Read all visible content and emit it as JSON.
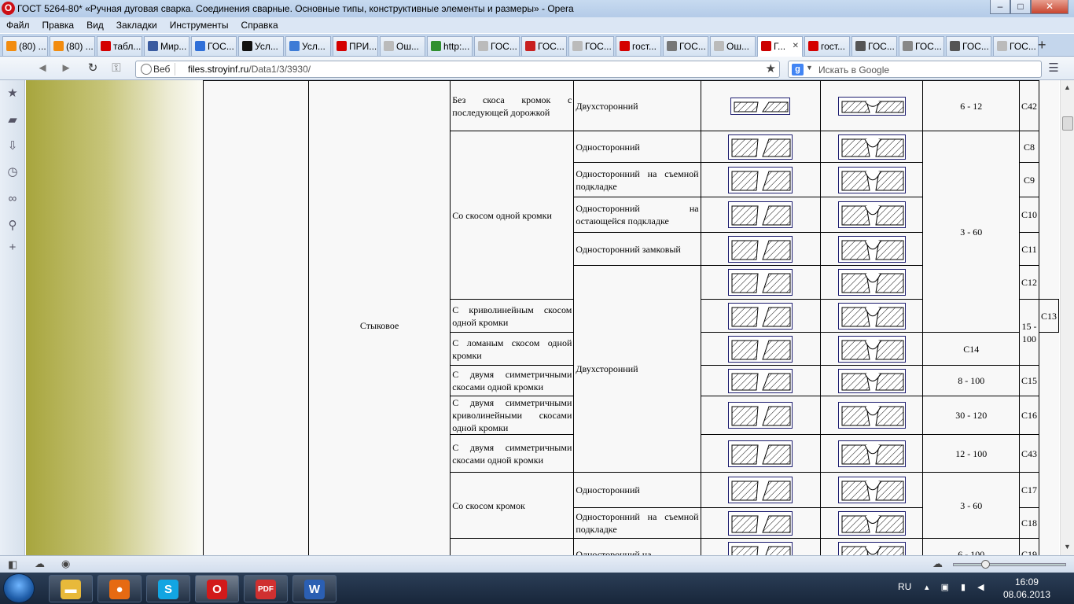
{
  "window": {
    "title": "ГОСТ 5264-80* «Ручная дуговая сварка. Соединения сварные. Основные типы, конструктивные элементы и размеры» - Opera",
    "minimize": "–",
    "maximize": "□",
    "close": "✕"
  },
  "menu": [
    "Файл",
    "Правка",
    "Вид",
    "Закладки",
    "Инструменты",
    "Справка"
  ],
  "tabs": [
    {
      "label": "(80) ...",
      "icon": "odnoklassniki-icon",
      "color": "#f28c0f"
    },
    {
      "label": "(80) ...",
      "icon": "odnoklassniki-icon",
      "color": "#f28c0f"
    },
    {
      "label": "табл...",
      "icon": "yandex-icon",
      "color": "#d40000"
    },
    {
      "label": "Мир...",
      "icon": "site-icon",
      "color": "#3a5ba0"
    },
    {
      "label": "ГОС...",
      "icon": "site-icon",
      "color": "#2f6fd8"
    },
    {
      "label": "Усл...",
      "icon": "site-icon",
      "color": "#111111"
    },
    {
      "label": "Усл...",
      "icon": "site-icon",
      "color": "#3d7bd6"
    },
    {
      "label": "ПРИ...",
      "icon": "yandex-icon",
      "color": "#d40000"
    },
    {
      "label": "Ош...",
      "icon": "page-icon",
      "color": "#bbbbbb"
    },
    {
      "label": "http:...",
      "icon": "gear-icon",
      "color": "#2f8f2f"
    },
    {
      "label": "ГОС...",
      "icon": "page-icon",
      "color": "#bbbbbb"
    },
    {
      "label": "ГОС...",
      "icon": "site-icon",
      "color": "#c82020"
    },
    {
      "label": "ГОС...",
      "icon": "page-icon",
      "color": "#bbbbbb"
    },
    {
      "label": "гост...",
      "icon": "yandex-icon",
      "color": "#d40000"
    },
    {
      "label": "ГОС...",
      "icon": "site-icon",
      "color": "#777777"
    },
    {
      "label": "Ош...",
      "icon": "page-icon",
      "color": "#bbbbbb"
    },
    {
      "label": "Г...",
      "icon": "site-icon",
      "color": "#cc0000",
      "active": true,
      "close": "✕"
    },
    {
      "label": "гост...",
      "icon": "yandex-icon",
      "color": "#d40000"
    },
    {
      "label": "ГОС...",
      "icon": "site-icon",
      "color": "#555555"
    },
    {
      "label": "ГОС...",
      "icon": "site-icon",
      "color": "#888888"
    },
    {
      "label": "ГОС...",
      "icon": "site-icon",
      "color": "#555555"
    },
    {
      "label": "ГОС...",
      "icon": "page-icon",
      "color": "#bbbbbb"
    }
  ],
  "new_tab": "+",
  "address": {
    "web_label": "Веб",
    "host": "files.stroyinf.ru",
    "path": "/Data1/3/3930/"
  },
  "search": {
    "engine": "g",
    "placeholder": "Искать в Google"
  },
  "table": {
    "joint_type": "Стыковое",
    "rows": [
      {
        "row": 1,
        "edge": "Без скоса кромок с последующей дорожкой",
        "side": "Двухсторонний",
        "thickness": "6 - 12",
        "code": "С42"
      },
      {
        "row": 2,
        "edge": "Со скосом одной кромки",
        "side": "Односторонний",
        "thickness": "3 - 60",
        "code": "С8"
      },
      {
        "row": 3,
        "side": "Односторонний на съемной подкладке",
        "code": "С9"
      },
      {
        "row": 4,
        "side": "Односторонний на остающейся подкладке",
        "code": "С10"
      },
      {
        "row": 5,
        "side": "Односторонний замковый",
        "code": "С11"
      },
      {
        "row": 6,
        "side": "Двухсторонний",
        "code": "С12"
      },
      {
        "row": 7,
        "edge": "С криволинейным скосом одной кромки",
        "thickness": "15 - 100",
        "code": "С13"
      },
      {
        "row": 8,
        "edge": "С ломаным скосом одной кромки",
        "code": "С14"
      },
      {
        "row": 9,
        "edge": "С двумя симметричными скосами одной кромки",
        "thickness": "8 - 100",
        "code": "С15"
      },
      {
        "row": 10,
        "edge": "С двумя симметричными криволинейными скосами одной кромки",
        "thickness": "30 - 120",
        "code": "С16"
      },
      {
        "row": 11,
        "edge": "С двумя симметричными скосами одной кромки",
        "thickness": "12 - 100",
        "code": "С43"
      },
      {
        "row": 12,
        "edge": "Со скосом кромок",
        "side": "Односторонний",
        "thickness": "3 - 60",
        "code": "С17"
      },
      {
        "row": 13,
        "side": "Односторонний на съемной подкладке",
        "code": "С18"
      },
      {
        "row": 14,
        "side": "Односторонний на",
        "thickness": "6 - 100",
        "code": "С19"
      }
    ]
  },
  "taskbar": {
    "apps": [
      {
        "name": "explorer",
        "glyph": "▬",
        "color": "#e8b93a"
      },
      {
        "name": "firefox",
        "glyph": "●",
        "color": "#e66a12"
      },
      {
        "name": "skype",
        "glyph": "S",
        "color": "#12a5e2"
      },
      {
        "name": "opera",
        "glyph": "O",
        "color": "#d21a1a"
      },
      {
        "name": "pdf-viewer",
        "glyph": "PDF",
        "color": "#d03030"
      },
      {
        "name": "word",
        "glyph": "W",
        "color": "#2b5fb3"
      }
    ],
    "lang": "RU",
    "time": "16:09",
    "date": "08.06.2013"
  }
}
